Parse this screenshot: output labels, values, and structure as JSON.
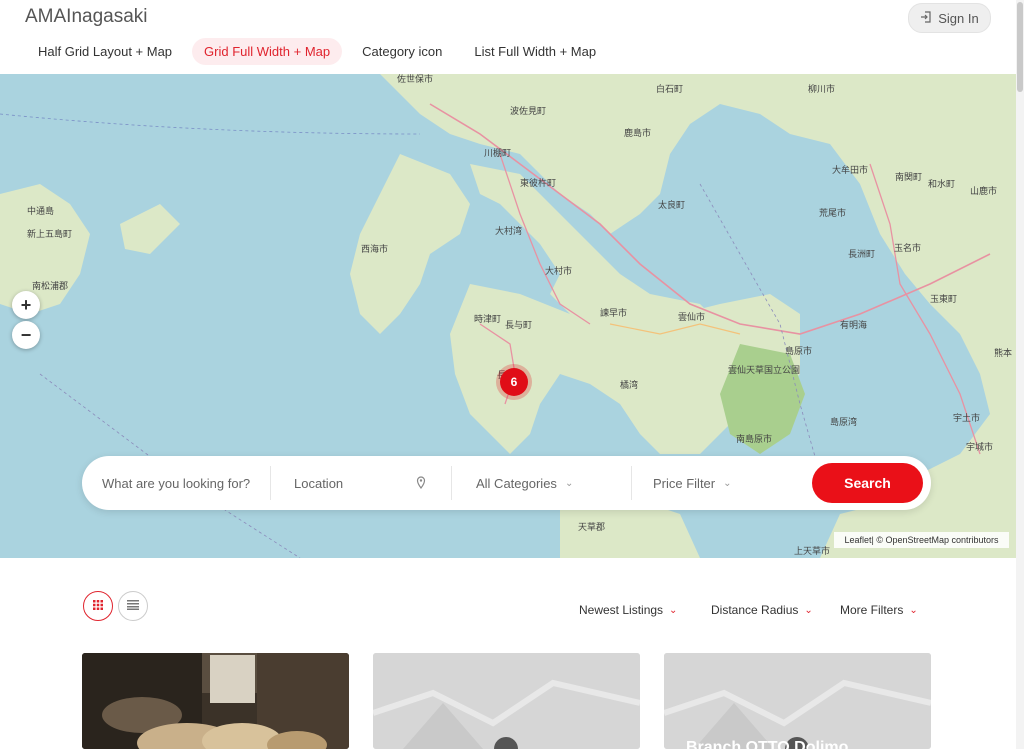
{
  "header": {
    "brand": "AMAInagasaki",
    "signin_label": "Sign In",
    "nav": [
      {
        "label": "Half Grid Layout + Map",
        "active": false
      },
      {
        "label": "Grid Full Width + Map",
        "active": true
      },
      {
        "label": "Category icon",
        "active": false
      },
      {
        "label": "List Full Width + Map",
        "active": false
      }
    ]
  },
  "map": {
    "zoom_in": "+",
    "zoom_out": "−",
    "cluster_count": "6",
    "attribution_leaflet": "Leaflet",
    "attribution_rest": " | © OpenStreetMap contributors",
    "labels": [
      "佐世保市",
      "波佐見町",
      "川棚町",
      "東彼杵町",
      "鹿島市",
      "太良町",
      "白石町",
      "柳川市",
      "大牟田市",
      "荒尾市",
      "玉名市",
      "山鹿市",
      "熊本",
      "中通島",
      "新上五島町",
      "南松浦郡",
      "西海市",
      "大村湾",
      "大村市",
      "諫早市",
      "雲仙市",
      "時津町",
      "長与町",
      "長崎市",
      "島原市",
      "雲仙天草国立公園",
      "橘湾",
      "南島原市",
      "有明海",
      "島原湾",
      "宇土市",
      "宇城市",
      "天草郡",
      "上天草市",
      "南関町",
      "和水町",
      "長洲町",
      "玉東町"
    ]
  },
  "search": {
    "keyword_placeholder": "What are you looking for?",
    "location_placeholder": "Location",
    "category_label": "All Categories",
    "price_label": "Price Filter",
    "button_label": "Search"
  },
  "listing_controls": {
    "sort_label": "Newest Listings",
    "distance_label": "Distance Radius",
    "more_filters_label": "More Filters"
  },
  "cards": [
    {
      "title": ""
    },
    {
      "title": ""
    },
    {
      "title": "Branch OTTO Dolimo"
    }
  ],
  "colors": {
    "accent": "#e0242e",
    "water": "#aad3df",
    "land": "#dce8c7"
  }
}
